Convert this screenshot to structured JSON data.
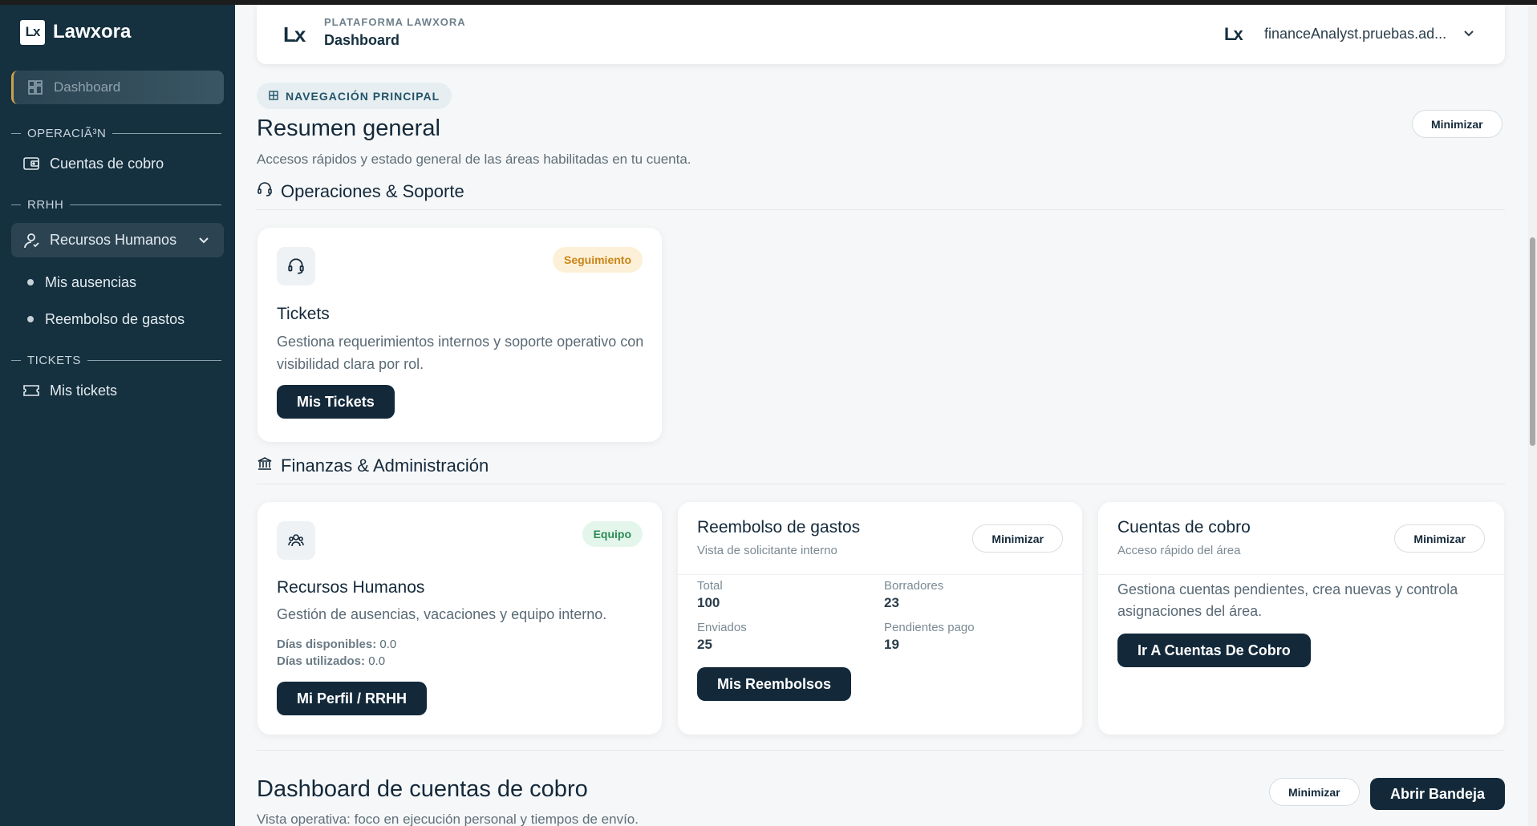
{
  "sidebar": {
    "brand_logo": "Lx",
    "brand_name": "Lawxora",
    "dashboard_label": "Dashboard",
    "sections": [
      {
        "title": "OPERACIÃ³N",
        "items": [
          "Cuentas de cobro"
        ]
      },
      {
        "title": "RRHH",
        "group_label": "Recursos Humanos",
        "subitems": [
          "Mis ausencias",
          "Reembolso de gastos"
        ]
      },
      {
        "title": "TICKETS",
        "items": [
          "Mis tickets"
        ]
      }
    ]
  },
  "header": {
    "logo": "Lx",
    "kicker": "PLATAFORMA LAWXORA",
    "title": "Dashboard",
    "user": "financeAnalyst.pruebas.ad..."
  },
  "overview": {
    "nav_pill": "NAVEGACIÓN PRINCIPAL",
    "title": "Resumen general",
    "subtitle": "Accesos rápidos y estado general de las áreas habilitadas en tu cuenta.",
    "minimize_label": "Minimizar"
  },
  "section_ops": {
    "title": "Operaciones & Soporte",
    "tickets_card": {
      "badge": "Seguimiento",
      "title": "Tickets",
      "description": "Gestiona requerimientos internos y soporte operativo con visibilidad clara por rol.",
      "button": "Mis Tickets"
    }
  },
  "section_fin": {
    "title": "Finanzas & Administración",
    "hr_card": {
      "badge": "Equipo",
      "title": "Recursos Humanos",
      "description": "Gestión de ausencias, vacaciones y equipo interno.",
      "days_available_label": "Días disponibles:",
      "days_available": "0.0",
      "days_used_label": "Días utilizados:",
      "days_used": "0.0",
      "button": "Mi Perfil / RRHH"
    },
    "reimb_card": {
      "title": "Reembolso de gastos",
      "subtitle": "Vista de solicitante interno",
      "minimize_label": "Minimizar",
      "stats": [
        {
          "label": "Total",
          "value": "100"
        },
        {
          "label": "Borradores",
          "value": "23"
        },
        {
          "label": "Enviados",
          "value": "25"
        },
        {
          "label": "Pendientes pago",
          "value": "19"
        }
      ],
      "button": "Mis Reembolsos"
    },
    "cobro_card": {
      "title": "Cuentas de cobro",
      "subtitle": "Acceso rápido del área",
      "minimize_label": "Minimizar",
      "description": "Gestiona cuentas pendientes, crea nuevas y controla asignaciones del área.",
      "button": "Ir A Cuentas De Cobro"
    }
  },
  "dashboard_cobro": {
    "title": "Dashboard de cuentas de cobro",
    "subtitle": "Vista operativa: foco en ejecución personal y tiempos de envío.",
    "minimize_label": "Minimizar",
    "open_tray_label": "Abrir Bandeja"
  },
  "colors": {
    "sidebar_bg": "#15303f",
    "primary_dark": "#13293a",
    "badge_orange": "#c98416",
    "badge_green": "#2c8a55"
  }
}
